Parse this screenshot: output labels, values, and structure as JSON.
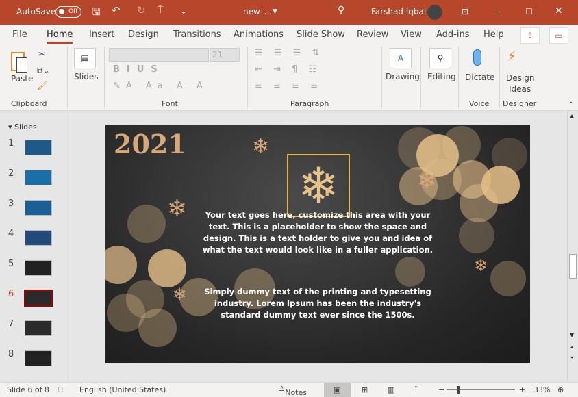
{
  "titlebar": {
    "autosave": "AutoSave",
    "autosave_state": "Off",
    "filename": "new_...",
    "user": "Farshad Iqbal"
  },
  "tabs": [
    "File",
    "Home",
    "Insert",
    "Design",
    "Transitions",
    "Animations",
    "Slide Show",
    "Review",
    "View",
    "Add-ins",
    "Help"
  ],
  "active_tab": "Home",
  "ribbon": {
    "paste": "Paste",
    "slides": "Slides",
    "font_size": "21",
    "drawing": "Drawing",
    "editing": "Editing",
    "dictate": "Dictate",
    "design_ideas_1": "Design",
    "design_ideas_2": "Ideas",
    "groups": [
      "Clipboard",
      "Font",
      "Paragraph",
      "Voice",
      "Designer"
    ]
  },
  "slides_panel": {
    "title": "Slides",
    "numbers": [
      "1",
      "2",
      "3",
      "4",
      "5",
      "6",
      "7",
      "8"
    ],
    "selected": 6
  },
  "slide": {
    "year": "2021",
    "paragraph1": "Your text goes here, customize this area with your text. This is a placeholder to show the space and design. This is a text holder to give you and idea of what the text would look like in a fuller application.",
    "paragraph2": "Simply dummy text of the printing and typesetting industry. Lorem Ipsum has been the industry's standard dummy text ever since the 1500s."
  },
  "status": {
    "slide_of": "Slide 6 of 8",
    "language": "English (United States)",
    "notes": "Notes",
    "zoom": "33%",
    "zoom_level": 33
  },
  "colors": {
    "accent": "#b7472a",
    "gold": "#e6b04a"
  }
}
